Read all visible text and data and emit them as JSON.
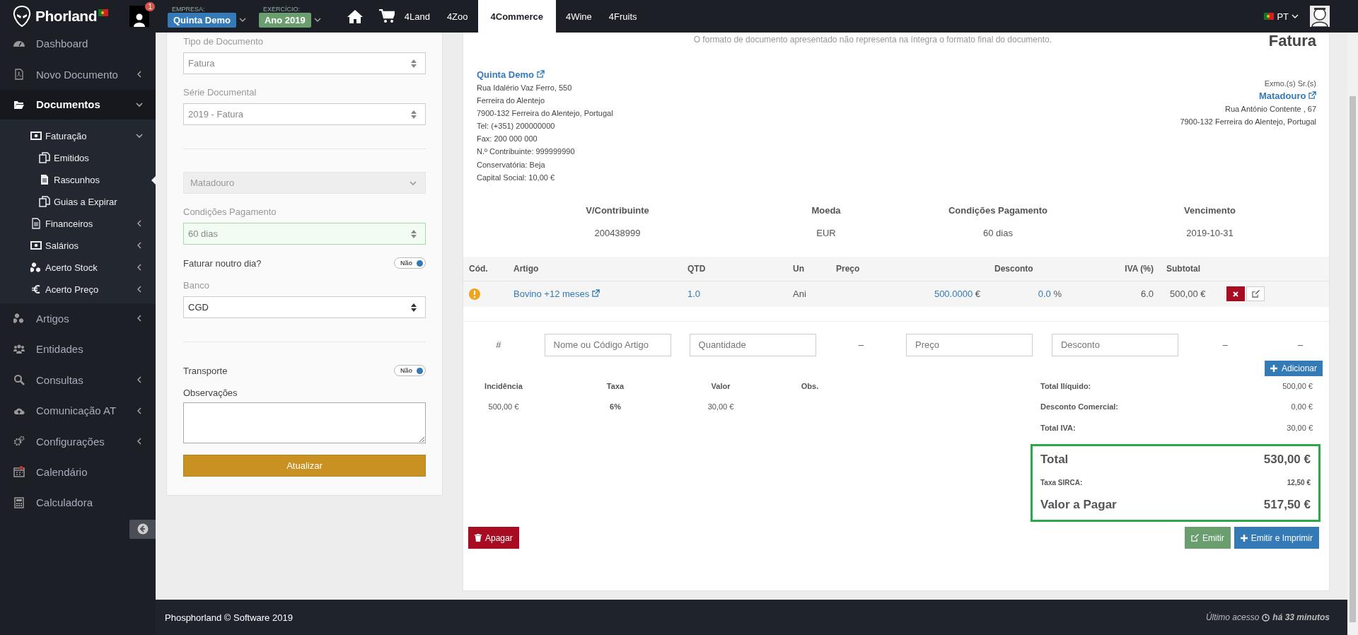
{
  "header": {
    "logo": "Phorland",
    "notifications": "1",
    "company_label": "EMPRESA:",
    "company": "Quinta Demo",
    "year_label": "EXERCÍCIO:",
    "year": "Ano 2019",
    "nav": [
      {
        "label": "4Land",
        "selected": false
      },
      {
        "label": "4Zoo",
        "selected": false
      },
      {
        "label": "4Commerce",
        "selected": true
      },
      {
        "label": "4Wine",
        "selected": false
      },
      {
        "label": "4Fruits",
        "selected": false
      }
    ],
    "language": "PT"
  },
  "sidebar": {
    "items": [
      {
        "label": "Dashboard",
        "expandable": false,
        "expanded": false,
        "selected": false
      },
      {
        "label": "Novo Documento",
        "expandable": true,
        "expanded": false,
        "selected": false
      },
      {
        "label": "Documentos",
        "expandable": true,
        "expanded": true,
        "selected": false,
        "children": [
          {
            "label": "Faturação",
            "expandable": true,
            "expanded": true,
            "selected": false,
            "children": [
              {
                "label": "Emitidos",
                "selected": false
              },
              {
                "label": "Rascunhos",
                "selected": true
              },
              {
                "label": "Guias a Expirar",
                "selected": false
              }
            ]
          },
          {
            "label": "Financeiros",
            "expandable": true,
            "expanded": false,
            "selected": false
          },
          {
            "label": "Salários",
            "expandable": true,
            "expanded": false,
            "selected": false
          },
          {
            "label": "Acerto Stock",
            "expandable": true,
            "expanded": false,
            "selected": false
          },
          {
            "label": "Acerto Preço",
            "expandable": true,
            "expanded": false,
            "selected": false
          }
        ]
      },
      {
        "label": "Artigos",
        "expandable": true,
        "expanded": false,
        "selected": false
      },
      {
        "label": "Entidades",
        "expandable": false,
        "expanded": false,
        "selected": false
      },
      {
        "label": "Consultas",
        "expandable": true,
        "expanded": false,
        "selected": false
      },
      {
        "label": "Comunicação AT",
        "expandable": true,
        "expanded": false,
        "selected": false
      },
      {
        "label": "Configurações",
        "expandable": true,
        "expanded": false,
        "selected": false
      },
      {
        "label": "Calendário",
        "expandable": false,
        "expanded": false,
        "selected": false
      },
      {
        "label": "Calculadora",
        "expandable": false,
        "expanded": false,
        "selected": false
      }
    ]
  },
  "form": {
    "fields": [
      {
        "kind": "select",
        "label": "Tipo de Documento",
        "value": "Fatura",
        "readonly": true,
        "disabled": false,
        "valid": false
      },
      {
        "kind": "select",
        "label": "Série Documental",
        "value": "2019 - Fatura",
        "readonly": true,
        "disabled": false,
        "valid": false
      },
      {
        "kind": "divider"
      },
      {
        "kind": "select",
        "value": "Matadouro",
        "readonly": true,
        "disabled": true,
        "valid": false
      },
      {
        "kind": "select",
        "label": "Condições Pagamento",
        "value": "60 dias",
        "readonly": true,
        "disabled": false,
        "valid": true
      },
      {
        "kind": "toggle",
        "label": "Faturar noutro dia?",
        "value": "Não",
        "on": false
      },
      {
        "kind": "select",
        "label": "Banco",
        "value": "CGD",
        "readonly": false,
        "disabled": false,
        "valid": false
      },
      {
        "kind": "divider"
      },
      {
        "kind": "toggle",
        "label": "Transporte",
        "value": "Não",
        "on": false
      },
      {
        "kind": "textarea",
        "label": "Observações"
      }
    ],
    "submit": "Atualizar"
  },
  "invoice": {
    "notice": "O formato de documento apresentado não representa na íntegra o formato final do documento.",
    "title": "Fatura",
    "issuer": {
      "name": "Quinta Demo",
      "lines": [
        "Rua Idalério Vaz Ferro, 550",
        "Ferreira do Alentejo",
        "7900-132 Ferreira do Alentejo, Portugal",
        "Tel: (+351) 200000000",
        "Fax: 200 000 000",
        "N.º Contribuinte: 999999990",
        "Conservatória: Beja",
        "Capital Social: 10,00 €"
      ]
    },
    "recipient": {
      "salutation": "Exmo.(s) Sr.(s)",
      "name": "Matadouro",
      "lines": [
        "Rua António Contente , 67",
        "7900-132 Ferreira do Alentejo, Portugal"
      ]
    },
    "info": [
      {
        "label": "V/Contribuinte",
        "value": "200438999"
      },
      {
        "label": "Moeda",
        "value": "EUR"
      },
      {
        "label": "Condições Pagamento",
        "value": "60 dias"
      },
      {
        "label": "Vencimento",
        "value": "2019-10-31"
      }
    ],
    "columns": [
      "Cód.",
      "Artigo",
      "QTD",
      "Un",
      "Preço",
      "Desconto",
      "IVA (%)",
      "Subtotal"
    ],
    "rows": [
      {
        "warning": true,
        "article": "Bovino +12 meses",
        "qty": "1.0",
        "unit": "Ani",
        "price": "500.0000",
        "price_unit": "€",
        "discount": "0.0",
        "discount_unit": "%",
        "vat": "6.0",
        "subtotal": "500,00 €"
      }
    ],
    "new_line": [
      {
        "kind": "label",
        "text": "#"
      },
      {
        "kind": "input",
        "placeholder": "Nome ou Código Artigo"
      },
      {
        "kind": "input",
        "placeholder": "Quantidade"
      },
      {
        "kind": "label",
        "text": "–"
      },
      {
        "kind": "input",
        "placeholder": "Preço"
      },
      {
        "kind": "input",
        "placeholder": "Desconto"
      },
      {
        "kind": "label",
        "text": "–"
      },
      {
        "kind": "label",
        "text": "–"
      }
    ],
    "add_button": "Adicionar",
    "tax_columns": [
      "Incidência",
      "Taxa",
      "Valor",
      "Obs."
    ],
    "tax_rows": [
      [
        "500,00 €",
        "6%",
        "30,00 €"
      ]
    ],
    "totals": [
      {
        "label": "Total Ilíquido:",
        "value": "500,00 €"
      },
      {
        "label": "Desconto Comercial:",
        "value": "0,00 €"
      },
      {
        "label": "Total IVA:",
        "value": "30,00 €"
      }
    ],
    "summary": [
      {
        "kind": "grand",
        "label": "Total",
        "value": "530,00 €"
      },
      {
        "kind": "minor",
        "label": "Taxa SIRCA:",
        "value": "12,50 €"
      },
      {
        "kind": "grand",
        "label": "Valor a Pagar",
        "value": "517,50 €"
      }
    ],
    "delete_button": "Apagar",
    "issue_button": "Emitir",
    "issue_print_button": "Emitir e Imprimir"
  },
  "footer": {
    "copyright": "Phosphorland © Software 2019",
    "last_access_label": "Último acesso",
    "last_access": "há 33 minutos"
  }
}
